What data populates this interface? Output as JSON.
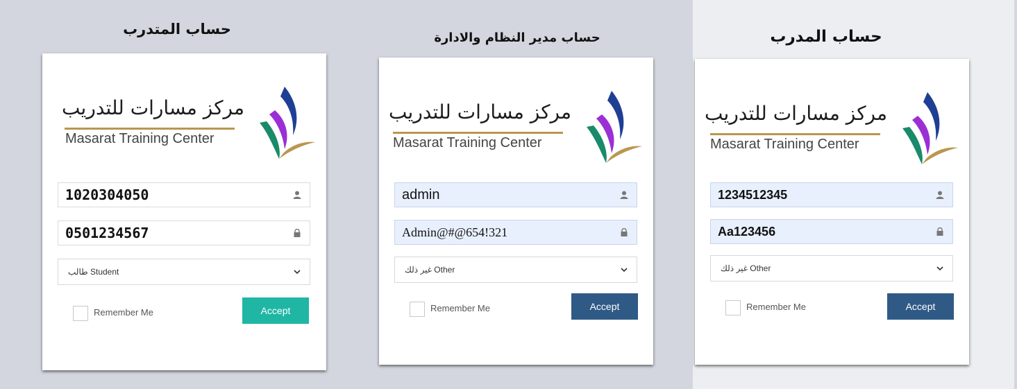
{
  "colors": {
    "background": "#d3d6df",
    "accept_teal": "#1fb6a4",
    "accept_navy": "#2f5a86",
    "autofill_field": "#e8f0fe",
    "logo_gold": "#b9974f",
    "logo_green": "#1a8a6a",
    "logo_blue": "#1f3f95",
    "logo_purple": "#9b2fd6"
  },
  "panels": {
    "student": {
      "heading": "حساب المتدرب",
      "logo_ar": "مركز مسارات للتدريب",
      "logo_en": "Masarat Training Center",
      "username": "1020304050",
      "password": "0501234567",
      "role": "طالب Student",
      "remember": "Remember Me",
      "accept": "Accept"
    },
    "admin": {
      "heading": "حساب مدير النظام والادارة",
      "logo_ar": "مركز مسارات للتدريب",
      "logo_en": "Masarat Training Center",
      "username": "admin",
      "password": "Admin@#@654!321",
      "role": "غير ذلك Other",
      "remember": "Remember Me",
      "accept": "Accept"
    },
    "trainer": {
      "heading": "حساب المدرب",
      "logo_ar": "مركز مسارات للتدريب",
      "logo_en": "Masarat Training Center",
      "username": "1234512345",
      "password": "Aa123456",
      "role": "غير ذلك Other",
      "remember": "Remember Me",
      "accept": "Accept"
    }
  },
  "icons": {
    "username": "user-icon",
    "password": "lock-icon",
    "select": "chevron-down-icon",
    "logo": "masarat-logo-mark"
  }
}
